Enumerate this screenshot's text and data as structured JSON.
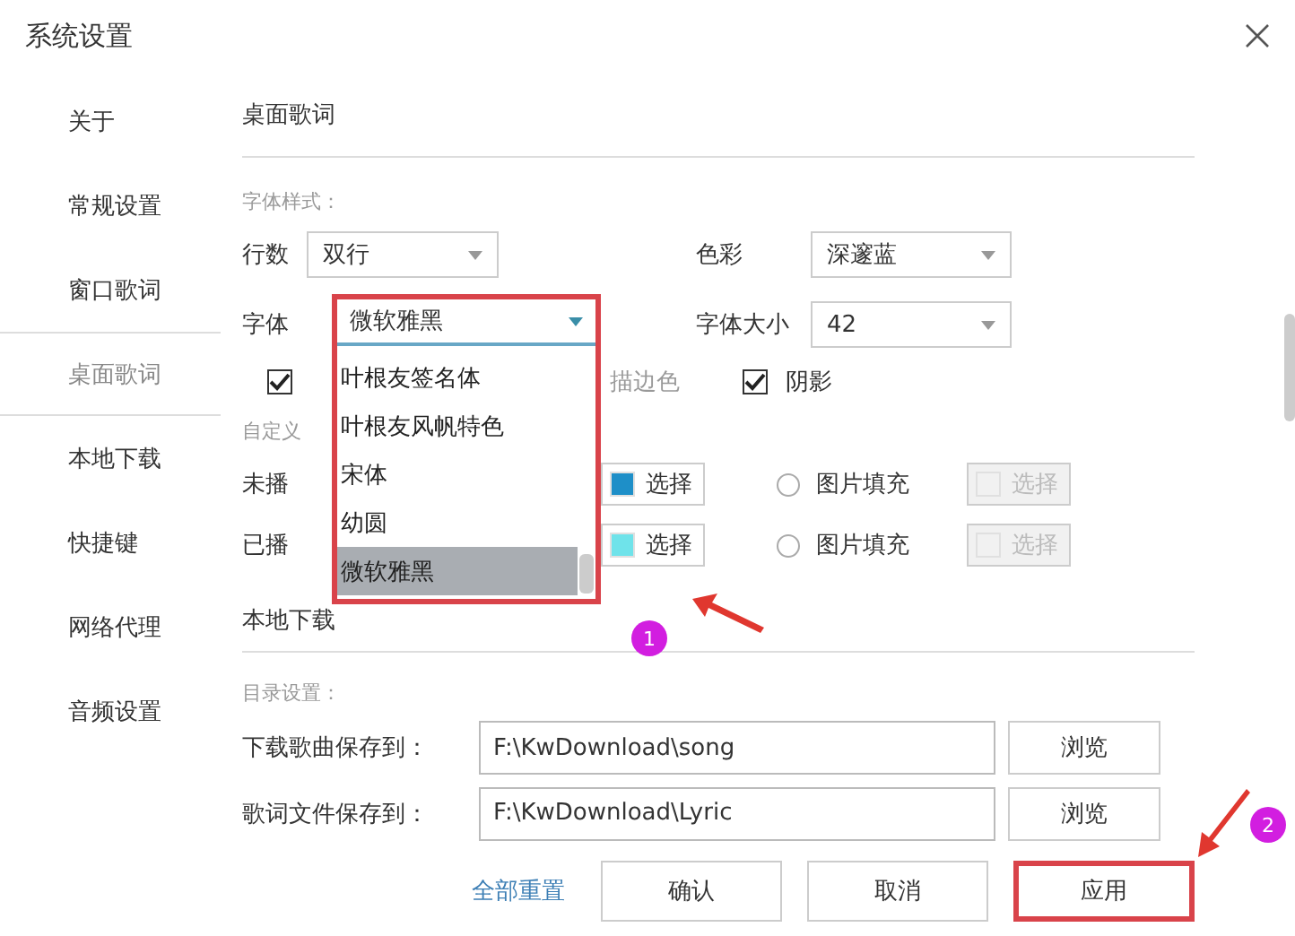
{
  "window": {
    "title": "系统设置"
  },
  "sidebar": {
    "items": [
      {
        "label": "关于",
        "selected": false
      },
      {
        "label": "常规设置",
        "selected": false
      },
      {
        "label": "窗口歌词",
        "selected": false
      },
      {
        "label": "桌面歌词",
        "selected": true
      },
      {
        "label": "本地下载",
        "selected": false
      },
      {
        "label": "快捷键",
        "selected": false
      },
      {
        "label": "网络代理",
        "selected": false
      },
      {
        "label": "音频设置",
        "selected": false
      }
    ]
  },
  "section_title": "桌面歌词",
  "font_style": {
    "heading": "字体样式：",
    "lines": {
      "label": "行数",
      "value": "双行"
    },
    "color": {
      "label": "色彩",
      "value": "深邃蓝"
    },
    "font": {
      "label": "字体",
      "value": "微软雅黑"
    },
    "size": {
      "label": "字体大小",
      "value": "42"
    },
    "checkbox_1": {
      "checked": true
    },
    "outline": {
      "label": "描边色"
    },
    "shadow": {
      "label": "阴影",
      "checked": true
    }
  },
  "custom": {
    "heading": "自定义",
    "rows": [
      {
        "label": "未播",
        "button": "选择",
        "color": "#1e8fc8",
        "radio": "图片填充",
        "radio_selected": false,
        "picture_button": "选择"
      },
      {
        "label": "已播",
        "button": "选择",
        "color": "#6fe3ea",
        "radio": "图片填充",
        "radio_selected": false,
        "picture_button": "选择"
      }
    ]
  },
  "next_section": "本地下载",
  "directory": {
    "heading": "目录设置：",
    "rows": [
      {
        "label": "下载歌曲保存到：",
        "value": "F:\\KwDownload\\song",
        "button": "浏览"
      },
      {
        "label": "歌词文件保存到：",
        "value": "F:\\KwDownload\\Lyric",
        "button": "浏览"
      }
    ]
  },
  "footer": {
    "reset": "全部重置",
    "buttons": [
      {
        "label": "确认",
        "highlighted": false
      },
      {
        "label": "取消",
        "highlighted": false
      },
      {
        "label": "应用",
        "highlighted": true
      }
    ]
  },
  "font_dropdown": {
    "items": [
      {
        "label": "叶根友签名体",
        "selected": false
      },
      {
        "label": "叶根友风帆特色",
        "selected": false
      },
      {
        "label": "宋体",
        "selected": false
      },
      {
        "label": "幼圆",
        "selected": false
      },
      {
        "label": "微软雅黑",
        "selected": true
      }
    ]
  },
  "annotations": [
    {
      "label": "1"
    },
    {
      "label": "2"
    }
  ]
}
